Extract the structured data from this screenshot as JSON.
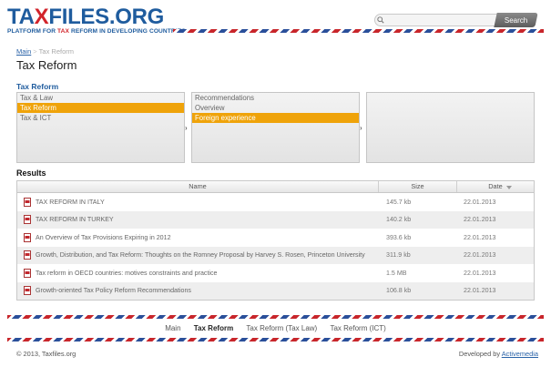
{
  "header": {
    "logo": {
      "part1": "TA",
      "part2": "X",
      "part3": "FILES.ORG"
    },
    "tagline": {
      "before": "PLATFORM FOR ",
      "highlight": "TAX",
      "after": " REFORM IN DEVELOPING COUNTRIES"
    },
    "search": {
      "placeholder": "",
      "button_label": "Search"
    }
  },
  "breadcrumb": {
    "items": [
      "Main",
      "Tax Reform"
    ],
    "separator": ">"
  },
  "page_title": "Tax Reform",
  "section_title": "Tax Reform",
  "selectors": {
    "box1": [
      {
        "label": "Tax & Law",
        "active": false
      },
      {
        "label": "Tax Reform",
        "active": true
      },
      {
        "label": "Tax & ICT",
        "active": false
      }
    ],
    "box2": [
      {
        "label": "Recommendations",
        "active": false
      },
      {
        "label": "Overview",
        "active": false
      },
      {
        "label": "Foreign experience",
        "active": true
      }
    ],
    "box3": [],
    "arrow": "›"
  },
  "results": {
    "title": "Results",
    "columns": {
      "name": "Name",
      "size": "Size",
      "date": "Date"
    },
    "rows": [
      {
        "name": "TAX REFORM IN ITALY",
        "size": "145.7 kb",
        "date": "22.01.2013"
      },
      {
        "name": "TAX REFORM IN TURKEY",
        "size": "140.2 kb",
        "date": "22.01.2013"
      },
      {
        "name": "An Overview of Tax Provisions Expiring in 2012",
        "size": "393.6 kb",
        "date": "22.01.2013"
      },
      {
        "name": "Growth, Distribution, and Tax Reform: Thoughts on the Romney Proposal by Harvey S. Rosen, Princeton University",
        "size": "311.9 kb",
        "date": "22.01.2013"
      },
      {
        "name": "Tax reform in OECD countries: motives constraints and practice",
        "size": "1.5 MB",
        "date": "22.01.2013"
      },
      {
        "name": "Growth-oriented Tax Policy Reform Recommendations",
        "size": "106.8 kb",
        "date": "22.01.2013"
      }
    ]
  },
  "footer": {
    "nav": [
      {
        "label": "Main",
        "current": false
      },
      {
        "label": "Tax Reform",
        "current": true
      },
      {
        "label": "Tax Reform (Tax Law)",
        "current": false
      },
      {
        "label": "Tax Reform (ICT)",
        "current": false
      }
    ],
    "copyright": "© 2013, Taxfiles.org",
    "developer_prefix": "Developed by ",
    "developer_link": "Activemedia"
  },
  "colors": {
    "brand_blue": "#1f5c9e",
    "brand_red": "#d2242b",
    "highlight": "#efa30a"
  }
}
